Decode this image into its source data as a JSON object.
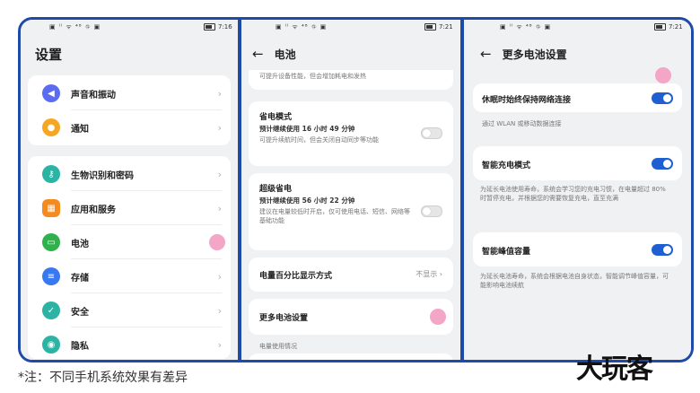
{
  "colors": {
    "frame": "#1f4aa8",
    "toggle_on": "#1f5fd1",
    "marker": "#f4a6c7",
    "background": "#f0f1f3"
  },
  "panel1": {
    "status": {
      "signal": "▣ ˡˡ ᯤ ⁴⁸ ⛗ ▣",
      "time": "7:16"
    },
    "title": "设置",
    "group1": [
      {
        "label": "声音和振动",
        "icon": "speaker-icon",
        "color": "#5b6cf0"
      },
      {
        "label": "通知",
        "icon": "bell-icon",
        "color": "#f5a623"
      }
    ],
    "group2": [
      {
        "label": "生物识别和密码",
        "icon": "key-icon",
        "color": "#2bb3a3"
      },
      {
        "label": "应用和服务",
        "icon": "apps-icon",
        "color": "#f58a1f"
      },
      {
        "label": "电池",
        "icon": "battery-icon",
        "color": "#2fb24c"
      },
      {
        "label": "存储",
        "icon": "storage-icon",
        "color": "#3a78f0"
      },
      {
        "label": "安全",
        "icon": "shield-icon",
        "color": "#2bb3a3"
      },
      {
        "label": "隐私",
        "icon": "privacy-icon",
        "color": "#2bb3a3"
      }
    ]
  },
  "panel2": {
    "status": {
      "signal": "▣ ˡˡ ᯤ ⁴⁸ ⛗ ▣",
      "time": "7:21"
    },
    "header": "电池",
    "top_desc": "可提升设备性能，但会增加耗电和发热",
    "power_save": {
      "title": "省电模式",
      "sub": "预计继续使用 16 小时 49 分钟",
      "desc": "可提升续航时间，但会关闭自动同步等功能"
    },
    "ultra_save": {
      "title": "超级省电",
      "sub": "预计继续使用 56 小时 22 分钟",
      "desc": "建议在电量较低时开启，仅可使用电话、短信、网络等基础功能"
    },
    "percent": {
      "label": "电量百分比显示方式",
      "value": "不显示"
    },
    "more": {
      "label": "更多电池设置"
    },
    "usage_label": "电量使用情况"
  },
  "panel3": {
    "status": {
      "signal": "▣ ˡˡ ᯤ ⁴⁸ ⛗ ▣",
      "time": "7:21"
    },
    "header": "更多电池设置",
    "network": {
      "label": "休眠时始终保持网络连接",
      "desc": "通过 WLAN 或移动数据连接",
      "on": true
    },
    "smart_charge": {
      "label": "智能充电模式",
      "desc": "为延长电池使用寿命，系统会学习您的充电习惯，在电量超过 80% 时暂停充电，并根据您的需要恢复充电，直至充满",
      "on": true
    },
    "peak_capacity": {
      "label": "智能峰值容量",
      "desc": "为延长电池寿命，系统会根据电池自身状态，智能调节峰值容量，可能影响电池续航",
      "on": true
    }
  },
  "footnote": "*注：不同手机系统效果有差异",
  "logo": "大玩客"
}
